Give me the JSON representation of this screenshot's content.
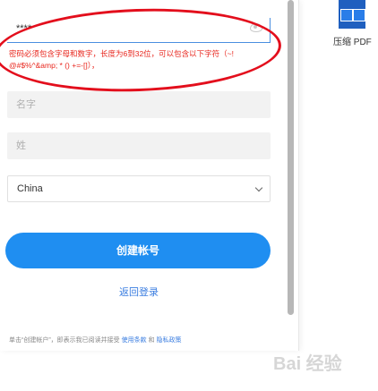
{
  "form": {
    "password_value": "****",
    "error_message": "密码必须包含字母和数字，长度为6到32位，可以包含以下字符（~! @#$%^&amp; * () +=-[]），",
    "first_name_placeholder": "名字",
    "last_name_placeholder": "姓",
    "country_value": "China",
    "create_button_label": "创建帐号",
    "back_link_label": "返回登录",
    "footer_prefix": "单击“创建帐户”，即表示我已阅读并接受",
    "footer_link_1": "使用条款",
    "footer_mid": "和",
    "footer_link_2": "隐私政策"
  },
  "desktop": {
    "icon_label": "压缩 PDF"
  },
  "watermark": "Bai 经验",
  "colors": {
    "accent": "#1f8ef1",
    "error": "#e8251c",
    "link": "#3a7de0"
  }
}
